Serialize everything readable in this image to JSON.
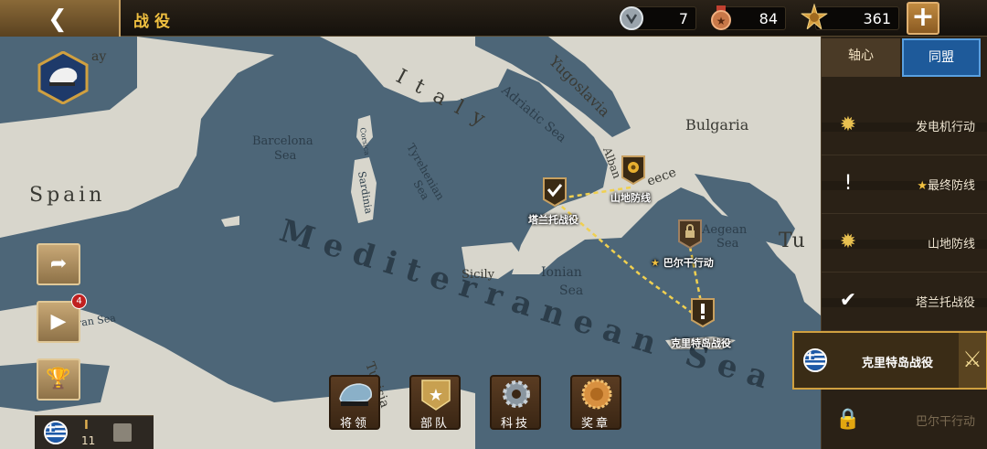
{
  "header": {
    "title": "战役",
    "back_icon": "chevron-left-icon"
  },
  "resources": [
    {
      "icon": "silver-medal-icon",
      "value": "7"
    },
    {
      "icon": "bronze-medal-icon",
      "value": "84"
    },
    {
      "icon": "gold-badge-icon",
      "value": "361"
    }
  ],
  "plus_label": "+",
  "map": {
    "labels": {
      "yugoslavia": "Yugoslavia",
      "italy": "Italy",
      "bulgaria": "Bulgaria",
      "barcelona_sea": "Barcelona",
      "barcelona_sea2": "Sea",
      "corsica": "Corsica",
      "sardinia": "Sardinia",
      "tyrehenian": "Tyrehenian",
      "tyrehenian2": "Sea",
      "adriatic": "Adriatic Sea",
      "albania": "Alban",
      "greece": "eece",
      "spain": "Spain",
      "mediterranean": "Mediterranean Sea",
      "sicily": "Sicily",
      "ionian": "Ionian",
      "ionian2": "Sea",
      "aegean": "Aegean",
      "aegean2": "Sea",
      "tu": "Tu",
      "alboran": "oran Sea",
      "tunisia": "Tunisia",
      "ay": "ay"
    },
    "markers": [
      {
        "name": "塔兰托战役",
        "state": "completed"
      },
      {
        "name": "山地防线",
        "state": "medal"
      },
      {
        "name": "巴尔干行动",
        "state": "locked",
        "star": "★"
      },
      {
        "name": "克里特岛战役",
        "state": "alert"
      }
    ]
  },
  "right_panel": {
    "tabs": [
      "轴心",
      "同盟"
    ],
    "active_tab": "同盟",
    "missions": [
      {
        "label": "发电机行动",
        "mark": "medal"
      },
      {
        "label": "最终防线",
        "mark": "alert",
        "star": "★"
      },
      {
        "label": "山地防线",
        "mark": "medal"
      },
      {
        "label": "塔兰托战役",
        "mark": "check"
      },
      {
        "label": "克里特岛战役",
        "mark": "flag",
        "selected": true
      },
      {
        "label": "巴尔干行动",
        "mark": "lock",
        "locked": true
      }
    ]
  },
  "left_column": {
    "notification_count": "4",
    "save": {
      "rank": "I",
      "number": "11"
    }
  },
  "bottom_menu": [
    {
      "label": "将领",
      "icon": "general-cap-icon"
    },
    {
      "label": "部队",
      "icon": "army-star-icon"
    },
    {
      "label": "科技",
      "icon": "tech-gear-icon"
    },
    {
      "label": "奖章",
      "icon": "medal-icon"
    }
  ],
  "colors": {
    "sea": "#4d6678",
    "land": "#d8d6cc",
    "accent": "#f0c040",
    "allies_tab": "#1e5a9a"
  }
}
